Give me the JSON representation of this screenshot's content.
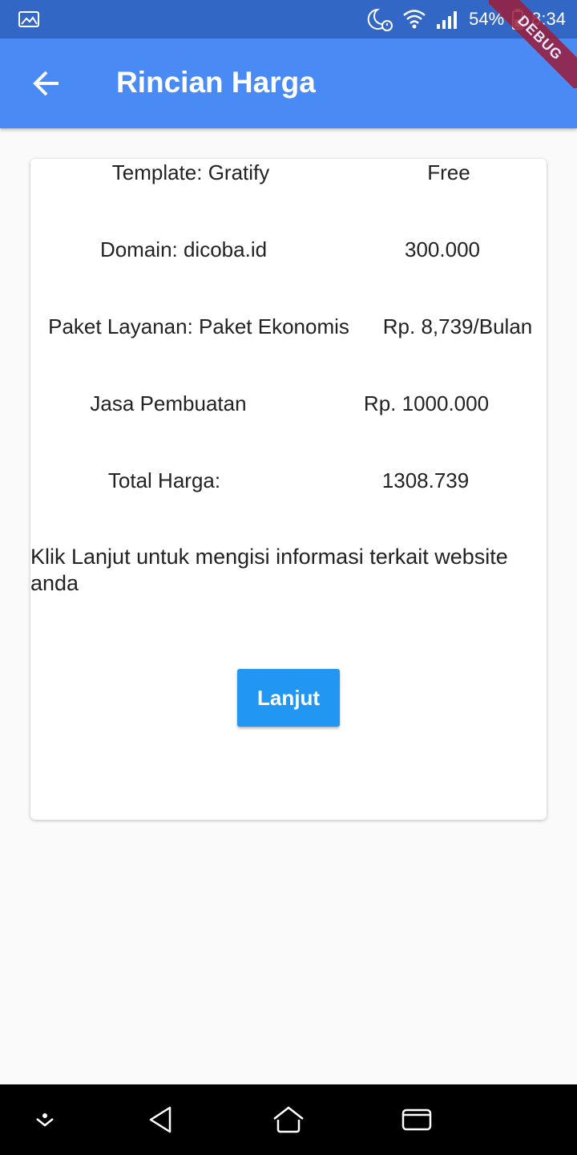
{
  "status_bar": {
    "battery": "54%",
    "time": "8:34",
    "icons": [
      "image-icon",
      "moon-alarm-icon",
      "wifi-icon",
      "signal-icon",
      "battery-icon"
    ]
  },
  "debug_banner": "DEBUG",
  "app_bar": {
    "title": "Rincian Harga",
    "back_icon": "arrow-left-icon"
  },
  "price_rows": [
    {
      "label": "Template: Gratify",
      "value": "Free"
    },
    {
      "label": "Domain: dicoba.id",
      "value": "300.000"
    },
    {
      "label": "Paket Layanan: Paket Ekonomis",
      "value": "Rp. 8,739/Bulan"
    },
    {
      "label": "Jasa Pembuatan",
      "value": "Rp. 1000.000"
    },
    {
      "label": "Total Harga:",
      "value": "1308.739"
    }
  ],
  "note": "Klik Lanjut untuk mengisi informasi terkait website anda",
  "continue_button": "Lanjut",
  "nav_bar": {
    "icons": [
      "chevron-down-dot-icon",
      "back-triangle-icon",
      "home-icon",
      "recents-icon"
    ]
  },
  "colors": {
    "status_bar": "#3367c6",
    "app_bar": "#4a8af4",
    "button": "#2196f3",
    "background": "#fafafa"
  }
}
